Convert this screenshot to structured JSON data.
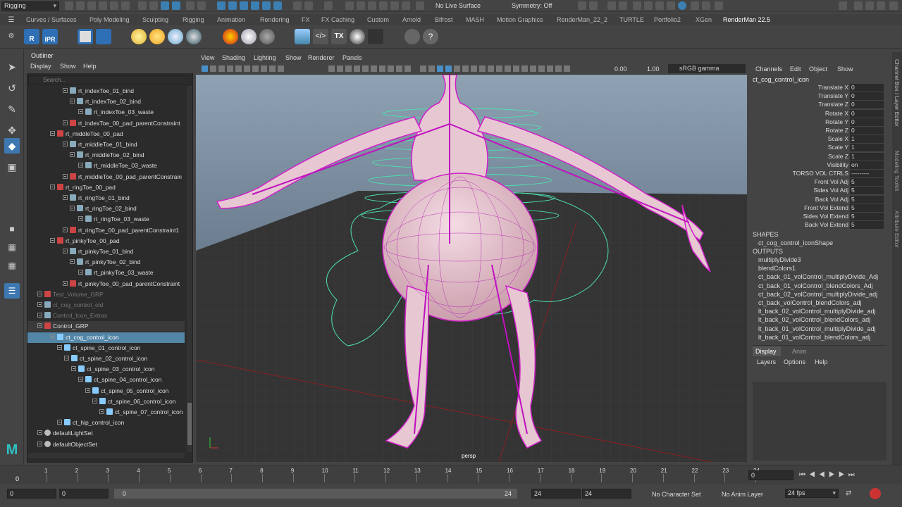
{
  "topbar": {
    "menuset": "Rigging",
    "live_surface": "No Live Surface",
    "symmetry": "Symmetry: Off"
  },
  "shelf_tabs": [
    "Curves / Surfaces",
    "Poly Modeling",
    "Sculpting",
    "Rigging",
    "Animation",
    "Rendering",
    "FX",
    "FX Caching",
    "Custom",
    "Arnold",
    "Bifrost",
    "MASH",
    "Motion Graphics",
    "RenderMan_22_2",
    "TURTLE",
    "Portfolio2",
    "XGen",
    "RenderMan 22.5"
  ],
  "shelf_labels": {
    "r": "R",
    "ipr": "IPR"
  },
  "outliner": {
    "title": "Outliner",
    "menus": [
      "Display",
      "Show",
      "Help"
    ],
    "search_placeholder": "Search...",
    "rows": [
      {
        "label": "rt_indexToe_01_bind",
        "indent": 50
      },
      {
        "label": "rt_indexToe_02_bind",
        "indent": 60
      },
      {
        "label": "rt_indexToe_03_waste",
        "indent": 72
      },
      {
        "label": "rt_indexToe_00_pad_parentConstraint",
        "indent": 50
      },
      {
        "label": "rt_middleToe_00_pad",
        "indent": 32
      },
      {
        "label": "rt_middleToe_01_bind",
        "indent": 50
      },
      {
        "label": "rt_middleToe_02_bind",
        "indent": 60
      },
      {
        "label": "rt_middleToe_03_waste",
        "indent": 72
      },
      {
        "label": "rt_middleToe_00_pad_parentConstrain",
        "indent": 50
      },
      {
        "label": "rt_ringToe_00_pad",
        "indent": 32
      },
      {
        "label": "rt_ringToe_01_bind",
        "indent": 50
      },
      {
        "label": "rt_ringToe_02_bind",
        "indent": 60
      },
      {
        "label": "rt_ringToe_03_waste",
        "indent": 72
      },
      {
        "label": "rt_ringToe_00_pad_parentConstraint1",
        "indent": 50
      },
      {
        "label": "rt_pinkyToe_00_pad",
        "indent": 32
      },
      {
        "label": "rt_pinkyToe_01_bind",
        "indent": 50
      },
      {
        "label": "rt_pinkyToe_02_bind",
        "indent": 60
      },
      {
        "label": "rt_pinkyToe_03_waste",
        "indent": 72
      },
      {
        "label": "rt_pinkyToe_00_pad_parentConstraint",
        "indent": 50
      },
      {
        "label": "Test_Volume_GRP",
        "indent": 14
      },
      {
        "label": "ct_cog_control_old",
        "indent": 14
      },
      {
        "label": "Control_Icon_Extras",
        "indent": 14
      },
      {
        "label": "Control_GRP",
        "indent": 14
      },
      {
        "label": "ct_cog_control_icon",
        "indent": 32
      },
      {
        "label": "ct_spine_01_control_icon",
        "indent": 42
      },
      {
        "label": "ct_spine_02_control_icon",
        "indent": 52
      },
      {
        "label": "ct_spine_03_control_icon",
        "indent": 62
      },
      {
        "label": "ct_spine_04_control_icon",
        "indent": 72
      },
      {
        "label": "ct_spine_05_control_icon",
        "indent": 82
      },
      {
        "label": "ct_spine_06_control_icon",
        "indent": 92
      },
      {
        "label": "ct_spine_07_control_icon",
        "indent": 102
      },
      {
        "label": "ct_hip_control_icon",
        "indent": 42
      },
      {
        "label": "defaultLightSet",
        "indent": 14
      },
      {
        "label": "defaultObjectSet",
        "indent": 14
      }
    ]
  },
  "viewport": {
    "menus": [
      "View",
      "Shading",
      "Lighting",
      "Show",
      "Renderer",
      "Panels"
    ],
    "value_a": "0.00",
    "value_b": "1.00",
    "colorspace": "sRGB gamma",
    "camera": "persp"
  },
  "channelbox": {
    "menus": [
      "Channels",
      "Edit",
      "Object",
      "Show"
    ],
    "object": "ct_cog_control_icon",
    "attrs": [
      {
        "name": "Translate X",
        "value": "0"
      },
      {
        "name": "Translate Y",
        "value": "0"
      },
      {
        "name": "Translate Z",
        "value": "0"
      },
      {
        "name": "Rotate X",
        "value": "0"
      },
      {
        "name": "Rotate Y",
        "value": "0"
      },
      {
        "name": "Rotate Z",
        "value": "0"
      },
      {
        "name": "Scale X",
        "value": "1"
      },
      {
        "name": "Scale Y",
        "value": "1"
      },
      {
        "name": "Scale Z",
        "value": "1"
      },
      {
        "name": "Visibility",
        "value": "on"
      },
      {
        "name": "TORSO VOL CTRLS",
        "value": "---------"
      },
      {
        "name": "Front Vol Adj",
        "value": "5"
      },
      {
        "name": "Sides Vol Adj",
        "value": "5"
      },
      {
        "name": "Back Vol Adj",
        "value": "5"
      },
      {
        "name": "Front Vol Extend",
        "value": "5"
      },
      {
        "name": "Sides Vol Extend",
        "value": "5"
      },
      {
        "name": "Back Vol Extend",
        "value": "5"
      }
    ],
    "shapes_label": "SHAPES",
    "shape": "ct_cog_control_iconShape",
    "outputs_label": "OUTPUTS",
    "outputs": [
      "multiplyDivide3",
      "blendColors1",
      "ct_back_01_volControl_multiplyDivide_Adj",
      "ct_back_01_volControl_blendColors_Adj",
      "ct_back_02_volControl_multiplyDivide_adj",
      "ct_back_volControl_blendColors_adj",
      "lt_back_02_volControl_multiplyDivide_adj",
      "lt_back_02_volControl_blendColors_adj",
      "lt_back_01_volControl_multiplyDivide_adj",
      "lt_back_01_volControl_blendColors_adj"
    ],
    "tabs": [
      "Display",
      "Anim"
    ],
    "layer_menus": [
      "Layers",
      "Options",
      "Help"
    ],
    "side_tabs": [
      "Channel Box / Layer Editor",
      "Modeling Toolkit",
      "Attribute Editor"
    ]
  },
  "timeline": {
    "ticks": [
      "1",
      "2",
      "3",
      "4",
      "5",
      "6",
      "7",
      "8",
      "9",
      "10",
      "11",
      "12",
      "13",
      "14",
      "15",
      "16",
      "17",
      "18",
      "19",
      "20",
      "21",
      "22",
      "23",
      "24"
    ],
    "current_frame": "0",
    "frame_field": "0"
  },
  "range": {
    "start": "0",
    "start2": "0",
    "slider_start": "0",
    "slider_end": "24",
    "end": "24",
    "end2": "24",
    "character_set": "No Character Set",
    "anim_layer": "No Anim Layer",
    "fps": "24 fps"
  }
}
